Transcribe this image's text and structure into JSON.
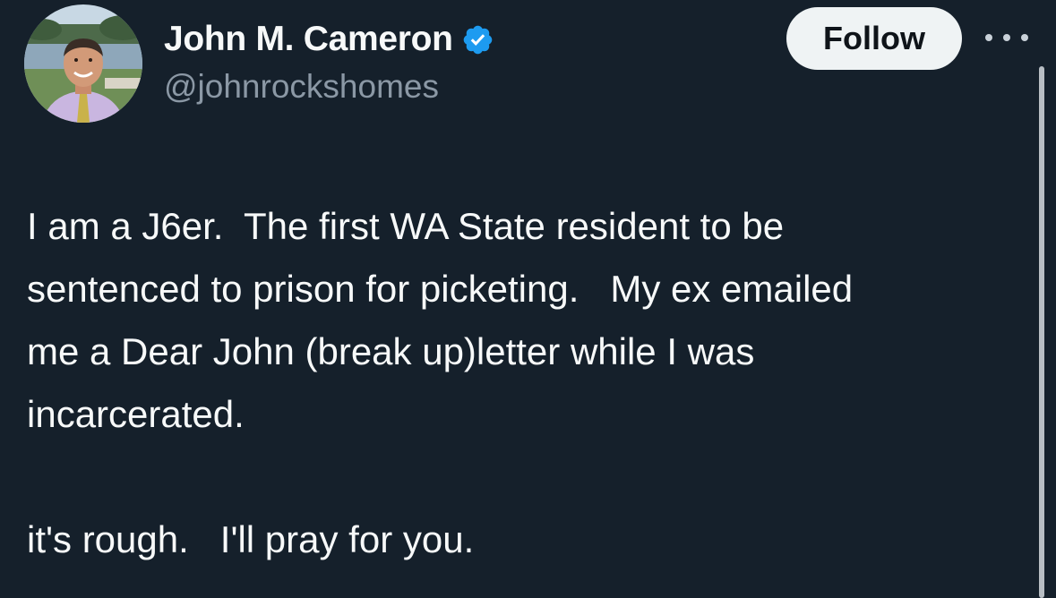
{
  "author": {
    "display_name": "John M. Cameron",
    "handle": "@johnrockshomes",
    "verified": true,
    "avatar": "profile-photo"
  },
  "actions": {
    "follow_label": "Follow",
    "more_icon": "more-horizontal-icon"
  },
  "tweet": {
    "paragraphs": [
      "I am a J6er.  The first WA State resident to be\nsentenced to prison for picketing.   My ex emailed\nme a Dear John (break up)letter while I was\nincarcerated.",
      "it's rough.   I'll pray for you."
    ]
  },
  "colors": {
    "background": "#15202b",
    "text": "#f7f9f9",
    "muted": "#8b98a5",
    "verified": "#1d9bf0",
    "follow_bg": "#eff3f4"
  }
}
